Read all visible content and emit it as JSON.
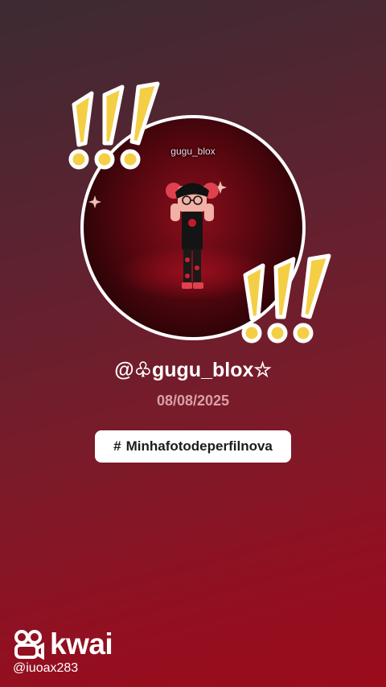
{
  "profile": {
    "inner_name": "gugu_blox",
    "username": "@♧gugu_blox☆",
    "date": "08/08/2025"
  },
  "hashtag": {
    "symbol": "#",
    "text": "Minhafotodeperfilnova"
  },
  "watermark": {
    "brand": "kwai",
    "handle": "@iuoax283"
  },
  "icons": [
    "exclamation-marks-icon",
    "kwai-logo-icon"
  ],
  "colors": {
    "exclaim_yellow": "#f4cf45",
    "background_top": "#3c2b32",
    "background_bottom": "#9a0c1c",
    "date_pink": "#d9a0a8"
  }
}
